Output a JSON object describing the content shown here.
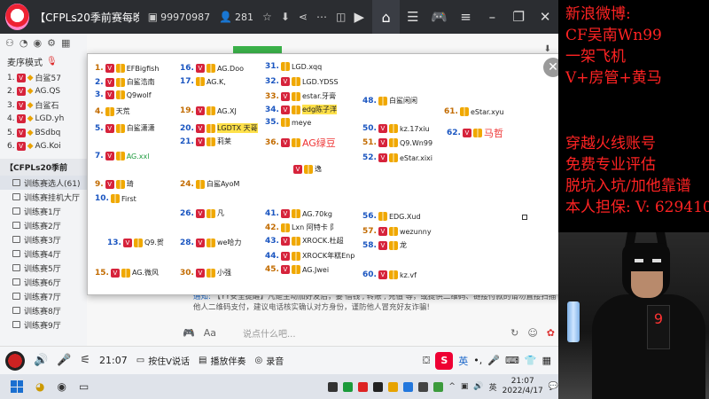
{
  "topbar": {
    "title": "【CFPLs20季前赛每晚7...",
    "room_id": "99970987",
    "users": "281"
  },
  "sidebar": {
    "mode_label": "麦序模式",
    "queue": [
      {
        "num": "1.",
        "name": "白鲨57"
      },
      {
        "num": "2.",
        "name": "AG.QS"
      },
      {
        "num": "3.",
        "name": "白鲨石"
      },
      {
        "num": "4.",
        "name": "LGD.yh"
      },
      {
        "num": "5.",
        "name": "BSdbq"
      },
      {
        "num": "6.",
        "name": "AG.Koi"
      }
    ],
    "group_title": "【CFPLs20季前",
    "channels": [
      "训练赛选人(61)",
      "训练赛挂机大厅",
      "训练赛1厅",
      "训练赛2厅",
      "训练赛3厅",
      "训练赛4厅",
      "训练赛5厅",
      "训练赛6厅",
      "训练赛7厅",
      "训练赛8厅",
      "训练赛9厅"
    ]
  },
  "popup": {
    "close": "✕",
    "entries": [
      {
        "n": "1.",
        "name": "EFBigfish"
      },
      {
        "n": "2.",
        "name": "白鲨浩南"
      },
      {
        "n": "3.",
        "name": "Q9wolf"
      },
      {
        "n": "4.",
        "name": "天荒"
      },
      {
        "n": "5.",
        "name": "白鲨潇潇"
      },
      {
        "n": "7.",
        "name": "AG.xxl"
      },
      {
        "n": "9.",
        "name": "琦"
      },
      {
        "n": "10.",
        "name": "First"
      },
      {
        "n": "13.",
        "name": "Q9.贺"
      },
      {
        "n": "15.",
        "name": "AG.微风"
      },
      {
        "n": "16.",
        "name": "AG.Doo"
      },
      {
        "n": "17.",
        "name": "AG.K,"
      },
      {
        "n": "19.",
        "name": "AG.XJ"
      },
      {
        "n": "20.",
        "name": "LGDTX 天哥"
      },
      {
        "n": "21.",
        "name": "莉莱"
      },
      {
        "n": "24.",
        "name": "白鲨AyoM"
      },
      {
        "n": "26.",
        "name": "凡"
      },
      {
        "n": "28.",
        "name": "we哈力"
      },
      {
        "n": "30.",
        "name": "小强"
      },
      {
        "n": "31.",
        "name": "LGD.xqq"
      },
      {
        "n": "32.",
        "name": "LGD.YDSS"
      },
      {
        "n": "33.",
        "name": "estar.牙膏"
      },
      {
        "n": "34.",
        "name": "edg陈子洋"
      },
      {
        "n": "35.",
        "name": "meye"
      },
      {
        "n": "36.",
        "name": "AG绿豆"
      },
      {
        "n": "",
        "name": "逸"
      },
      {
        "n": "41.",
        "name": "AG.70kg"
      },
      {
        "n": "42.",
        "name": "Lxn 阿特卡 阝"
      },
      {
        "n": "43.",
        "name": "XROCK.杜超"
      },
      {
        "n": "44.",
        "name": "XROCK年糕Enp"
      },
      {
        "n": "45.",
        "name": "AG.Jwei"
      },
      {
        "n": "48.",
        "name": "白鲨闲闲"
      },
      {
        "n": "50.",
        "name": "kz.17xiu"
      },
      {
        "n": "51.",
        "name": "Q9.Wn99"
      },
      {
        "n": "52.",
        "name": "eStar.xixi"
      },
      {
        "n": "56.",
        "name": "EDG.Xud"
      },
      {
        "n": "57.",
        "name": "wezunny"
      },
      {
        "n": "58.",
        "name": "龙"
      },
      {
        "n": "60.",
        "name": "kz.vf"
      },
      {
        "n": "61.",
        "name": "eStar.xyu"
      },
      {
        "n": "62.",
        "name": "马哲"
      }
    ]
  },
  "notice": {
    "label": "通知:",
    "text": "【YY安全提醒】凡是主动加好友后，要'借钱','转账','充值'等，或提供二维码、链接付款的请勿直接扫描他人二维码支付，建议电话核实确认对方身份，谨防他人冒充好友诈骗!"
  },
  "input": {
    "placeholder": "说点什么吧..."
  },
  "bottombar": {
    "time": "21:07",
    "ptt": "按住V说话",
    "music": "播放伴奏",
    "record": "录音",
    "ime": "英"
  },
  "taskbar": {
    "time": "21:07",
    "date": "2022/4/17"
  },
  "overlay": {
    "lines_top": [
      "新浪微博:",
      "CF吴南Wn99",
      "一架飞机",
      "V+房管+黄马"
    ],
    "lines_bottom": [
      "穿越火线账号",
      "免费专业评估",
      "脱坑入坑/加他靠谱",
      "本人担保: V: 629410"
    ],
    "box_digit": "9"
  }
}
